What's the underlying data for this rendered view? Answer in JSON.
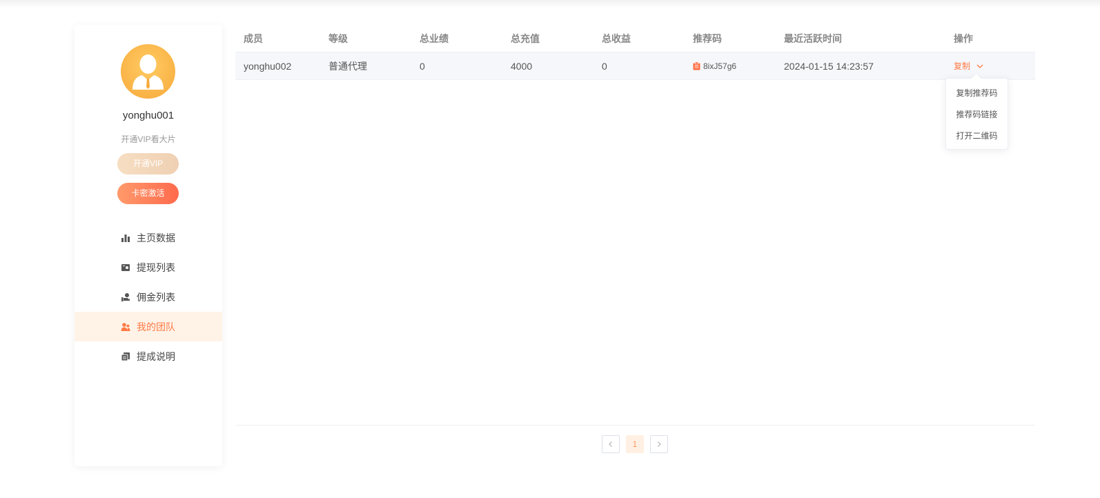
{
  "sidebar": {
    "username": "yonghu001",
    "vip_tip": "开通VIP看大片",
    "vip_button": "开通VIP",
    "card_button": "卡密激活",
    "menu": [
      {
        "label": "主页数据",
        "icon": "bar-chart-icon"
      },
      {
        "label": "提现列表",
        "icon": "wallet-icon"
      },
      {
        "label": "佣金列表",
        "icon": "hand-coin-icon"
      },
      {
        "label": "我的团队",
        "icon": "team-icon",
        "active": true
      },
      {
        "label": "提成说明",
        "icon": "document-icon"
      }
    ]
  },
  "table": {
    "headers": [
      "成员",
      "等级",
      "总业绩",
      "总充值",
      "总收益",
      "推荐码",
      "最近活跃时间",
      "操作"
    ],
    "rows": [
      {
        "member": "yonghu002",
        "level": "普通代理",
        "total_performance": "0",
        "total_recharge": "4000",
        "total_income": "0",
        "ref_code": "8ixJ57g6",
        "last_active": "2024-01-15 14:23:57",
        "action": "复制"
      }
    ]
  },
  "dropdown": {
    "items": [
      "复制推荐码",
      "推荐码链接",
      "打开二维码"
    ]
  },
  "pagination": {
    "prev": "<",
    "current": "1",
    "next": ">"
  },
  "colors": {
    "accent": "#ff7a45",
    "active_bg": "#fff3e8",
    "row_bg": "#f5f7fa"
  }
}
